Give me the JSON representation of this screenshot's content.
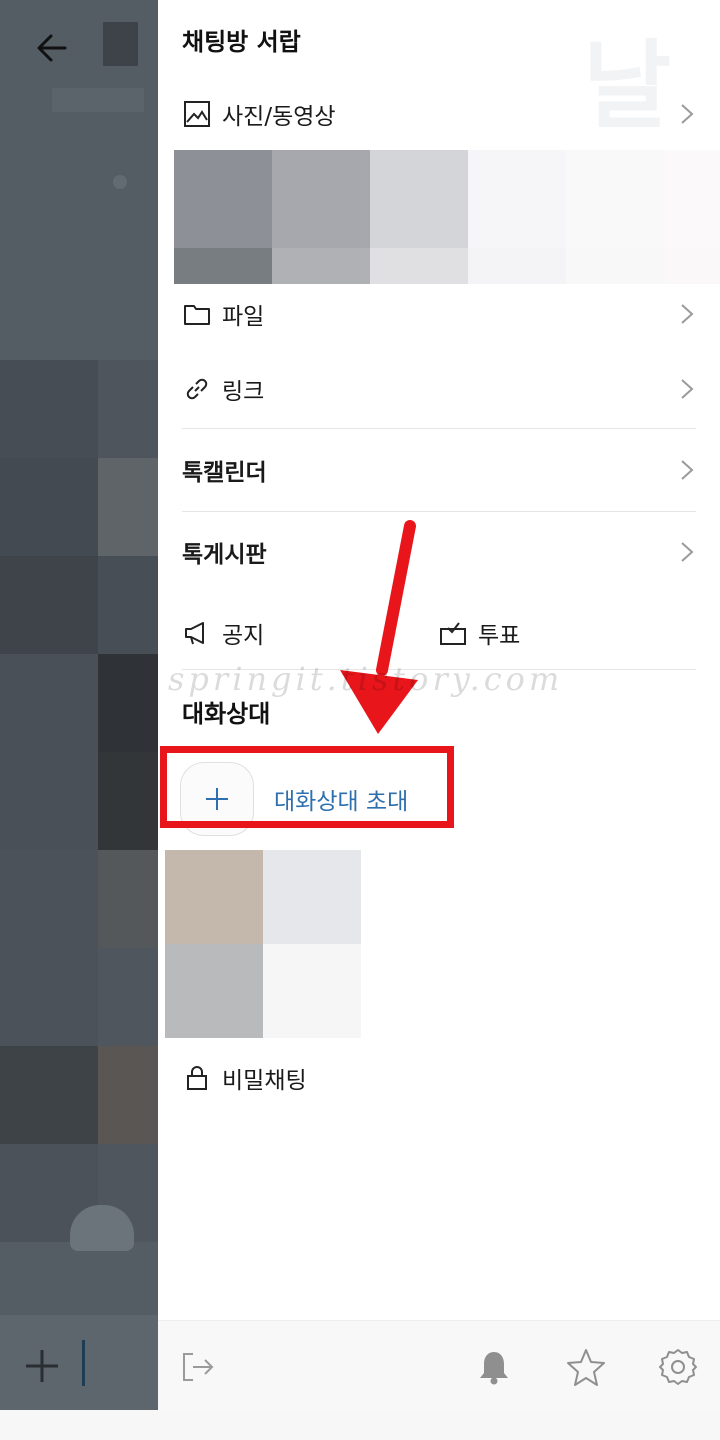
{
  "drawer": {
    "title": "채팅방 서랍",
    "watermark_glyph": "날"
  },
  "media": {
    "photos_label": "사진/동영상",
    "files_label": "파일",
    "links_label": "링크"
  },
  "tools": {
    "calendar_label": "톡캘린더",
    "board_label": "톡게시판",
    "notice_label": "공지",
    "vote_label": "투표"
  },
  "members": {
    "section_title": "대화상대",
    "invite_label": "대화상대 초대"
  },
  "secret_chat": {
    "label": "비밀채팅"
  },
  "watermark": {
    "text": "springit.tistory.com"
  },
  "icons": {
    "back": "back-arrow-icon",
    "photo": "image-icon",
    "folder": "folder-icon",
    "link": "link-icon",
    "chevron": "chevron-right-icon",
    "notice": "megaphone-icon",
    "vote": "ballot-icon",
    "plus": "plus-icon",
    "lock": "lock-icon",
    "exit": "exit-icon",
    "bell": "bell-icon",
    "star": "star-icon",
    "gear": "gear-icon"
  },
  "colors": {
    "accent_link": "#2e6fae",
    "annotation_red": "#e8151b",
    "overlay_dim": "#545c64"
  }
}
